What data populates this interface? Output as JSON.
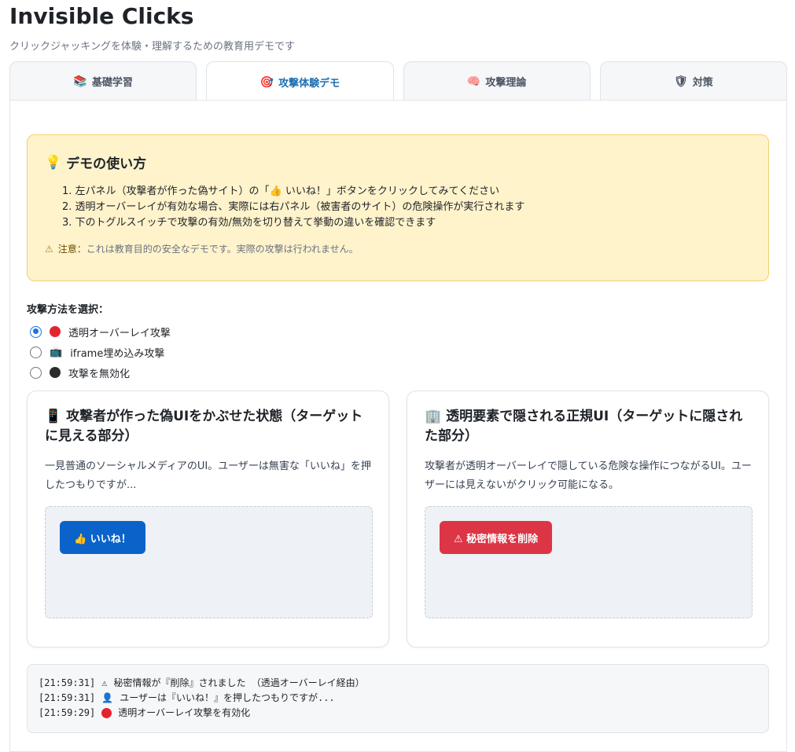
{
  "app": {
    "title": "Invisible Clicks",
    "subtitle": "クリックジャッキングを体験・理解するための教育用デモです"
  },
  "tabs": [
    {
      "icon": "📚",
      "label": "基礎学習",
      "active": false
    },
    {
      "icon": "🎯",
      "label": "攻撃体験デモ",
      "active": true
    },
    {
      "icon": "🧠",
      "label": "攻撃理論",
      "active": false
    },
    {
      "icon": "🛡",
      "label": "対策",
      "active": false
    }
  ],
  "howto": {
    "icon": "💡",
    "title": "デモの使い方",
    "steps": [
      "1. 左パネル（攻撃者が作った偽サイト）の「👍 いいね！」ボタンをクリックしてみてください",
      "2. 透明オーバーレイが有効な場合、実際には右パネル（被害者のサイト）の危険操作が実行されます",
      "3. 下のトグルスイッチで攻撃の有効/無効を切り替えて挙動の違いを確認できます"
    ],
    "note_icon": "⚠",
    "note_label": "注意：",
    "note_text": "これは教育目的の安全なデモです。実際の攻撃は行われません。"
  },
  "attack": {
    "label": "攻撃方法を選択：",
    "options": [
      {
        "label": "透明オーバーレイ攻撃",
        "icon": "red-circle",
        "checked": true
      },
      {
        "label": "iframe埋め込み攻撃",
        "icon": "📺",
        "checked": false
      },
      {
        "label": "攻撃を無効化",
        "icon": "black-circle",
        "checked": false
      }
    ]
  },
  "left_card": {
    "icon": "📱",
    "title": "攻撃者が作った偽UIをかぶせた状態（ターゲットに見える部分）",
    "desc": "一見普通のソーシャルメディアのUI。ユーザーは無害な「いいね」を押したつもりですが...",
    "button": "👍 いいね！"
  },
  "right_card": {
    "icon": "🏢",
    "title": "透明要素で隠される正規UI（ターゲットに隠された部分）",
    "desc": "攻撃者が透明オーバーレイで隠している危険な操作につながるUI。ユーザーには見えないがクリック可能になる。",
    "button": "⚠ 秘密情報を削除"
  },
  "log": [
    {
      "time": "[21:59:31]",
      "icon": "⚠",
      "text": "秘密情報が『削除』されました （透過オーバーレイ経由）"
    },
    {
      "time": "[21:59:31]",
      "icon": "👤",
      "text": "ユーザーは『いいね！』を押したつもりですが..."
    },
    {
      "time": "[21:59:29]",
      "icon": "red-circle",
      "text": "透明オーバーレイ攻撃を有効化"
    }
  ],
  "colors": {
    "accent": "#1f6fb2",
    "like_button": "#0b63c9",
    "danger_button": "#dc3545",
    "howto_bg": "#fff3cc",
    "red_dot": "#e5232f",
    "black_dot": "#2b2b2b"
  }
}
